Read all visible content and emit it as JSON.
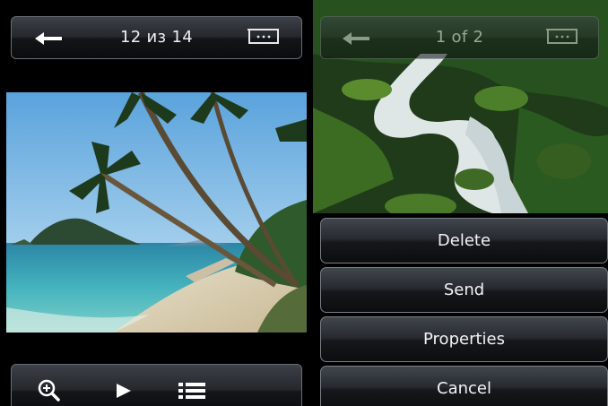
{
  "left": {
    "pager_text": "12 из 14",
    "icons": {
      "back": "back-arrow-icon",
      "fullscreen": "fullscreen-icon",
      "zoom": "zoom-in-icon",
      "play": "play-icon",
      "list": "list-icon"
    }
  },
  "right": {
    "pager_text": "1 of 2",
    "menu": [
      {
        "label": "Delete"
      },
      {
        "label": "Send"
      },
      {
        "label": "Properties"
      },
      {
        "label": "Cancel"
      }
    ]
  },
  "colors": {
    "bar_border": "#676c74",
    "text": "#eef0f2",
    "background": "#000000"
  }
}
